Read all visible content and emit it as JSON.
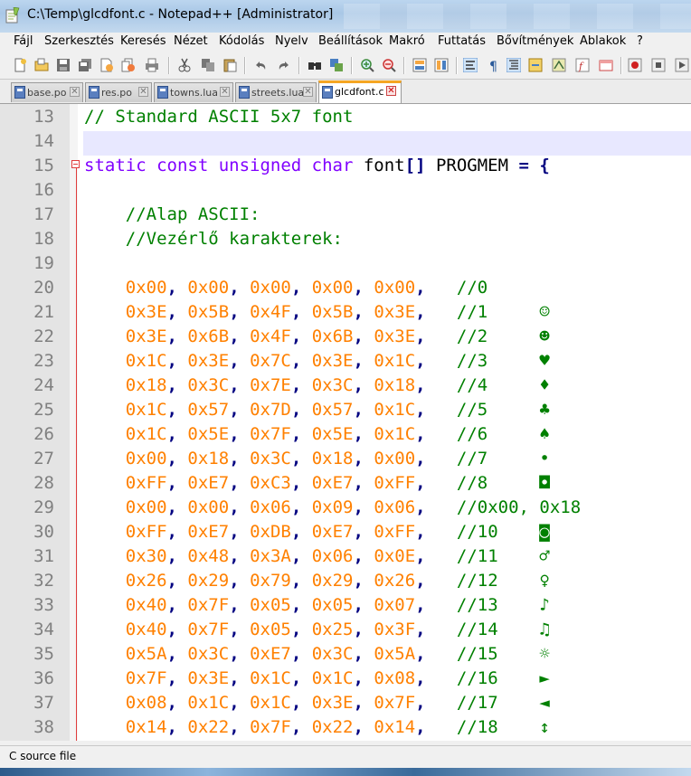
{
  "window": {
    "title": "C:\\Temp\\glcdfont.c - Notepad++ [Administrator]"
  },
  "menu": [
    {
      "label": "Fájl"
    },
    {
      "label": "Szerkesztés"
    },
    {
      "label": "Keresés"
    },
    {
      "label": "Nézet"
    },
    {
      "label": "Kódolás"
    },
    {
      "label": "Nyelv"
    },
    {
      "label": "Beállítások"
    },
    {
      "label": "Makró"
    },
    {
      "label": "Futtatás"
    },
    {
      "label": "Bővítmények"
    },
    {
      "label": "Ablakok"
    },
    {
      "label": "?"
    }
  ],
  "tabs": [
    {
      "label": "base.po",
      "active": false
    },
    {
      "label": "res.po",
      "active": false
    },
    {
      "label": "towns.lua",
      "active": false
    },
    {
      "label": "streets.lua",
      "active": false
    },
    {
      "label": "glcdfont.c",
      "active": true
    }
  ],
  "tab_close_glyph": "✕",
  "editor": {
    "current_line": 14,
    "lines": [
      {
        "n": "13",
        "segs": [
          {
            "t": "// Standard ASCII 5x7 font",
            "c": "cm"
          }
        ]
      },
      {
        "n": "14",
        "segs": []
      },
      {
        "n": "15",
        "segs": [
          {
            "t": "static const unsigned char",
            "c": "kw"
          },
          {
            "t": " font",
            "c": "pl"
          },
          {
            "t": "[]",
            "c": "op"
          },
          {
            "t": " PROGMEM ",
            "c": "pl"
          },
          {
            "t": "= {",
            "c": "op"
          }
        ]
      },
      {
        "n": "16",
        "segs": []
      },
      {
        "n": "17",
        "segs": [
          {
            "t": "    //Alap ASCII:",
            "c": "cm"
          }
        ]
      },
      {
        "n": "18",
        "segs": [
          {
            "t": "    //Vezérlő karakterek:",
            "c": "cm"
          }
        ]
      },
      {
        "n": "19",
        "segs": []
      },
      {
        "n": "20",
        "segs": [
          {
            "t": "    ",
            "c": "pl"
          },
          {
            "t": "0x00",
            "c": "hex"
          },
          {
            "t": ", ",
            "c": "op"
          },
          {
            "t": "0x00",
            "c": "hex"
          },
          {
            "t": ", ",
            "c": "op"
          },
          {
            "t": "0x00",
            "c": "hex"
          },
          {
            "t": ", ",
            "c": "op"
          },
          {
            "t": "0x00",
            "c": "hex"
          },
          {
            "t": ", ",
            "c": "op"
          },
          {
            "t": "0x00",
            "c": "hex"
          },
          {
            "t": ",   ",
            "c": "op"
          },
          {
            "t": "//0",
            "c": "cm"
          }
        ]
      },
      {
        "n": "21",
        "segs": [
          {
            "t": "    ",
            "c": "pl"
          },
          {
            "t": "0x3E",
            "c": "hex"
          },
          {
            "t": ", ",
            "c": "op"
          },
          {
            "t": "0x5B",
            "c": "hex"
          },
          {
            "t": ", ",
            "c": "op"
          },
          {
            "t": "0x4F",
            "c": "hex"
          },
          {
            "t": ", ",
            "c": "op"
          },
          {
            "t": "0x5B",
            "c": "hex"
          },
          {
            "t": ", ",
            "c": "op"
          },
          {
            "t": "0x3E",
            "c": "hex"
          },
          {
            "t": ",   ",
            "c": "op"
          },
          {
            "t": "//1     ☺",
            "c": "cm"
          }
        ]
      },
      {
        "n": "22",
        "segs": [
          {
            "t": "    ",
            "c": "pl"
          },
          {
            "t": "0x3E",
            "c": "hex"
          },
          {
            "t": ", ",
            "c": "op"
          },
          {
            "t": "0x6B",
            "c": "hex"
          },
          {
            "t": ", ",
            "c": "op"
          },
          {
            "t": "0x4F",
            "c": "hex"
          },
          {
            "t": ", ",
            "c": "op"
          },
          {
            "t": "0x6B",
            "c": "hex"
          },
          {
            "t": ", ",
            "c": "op"
          },
          {
            "t": "0x3E",
            "c": "hex"
          },
          {
            "t": ",   ",
            "c": "op"
          },
          {
            "t": "//2     ☻",
            "c": "cm"
          }
        ]
      },
      {
        "n": "23",
        "segs": [
          {
            "t": "    ",
            "c": "pl"
          },
          {
            "t": "0x1C",
            "c": "hex"
          },
          {
            "t": ", ",
            "c": "op"
          },
          {
            "t": "0x3E",
            "c": "hex"
          },
          {
            "t": ", ",
            "c": "op"
          },
          {
            "t": "0x7C",
            "c": "hex"
          },
          {
            "t": ", ",
            "c": "op"
          },
          {
            "t": "0x3E",
            "c": "hex"
          },
          {
            "t": ", ",
            "c": "op"
          },
          {
            "t": "0x1C",
            "c": "hex"
          },
          {
            "t": ",   ",
            "c": "op"
          },
          {
            "t": "//3     ♥",
            "c": "cm"
          }
        ]
      },
      {
        "n": "24",
        "segs": [
          {
            "t": "    ",
            "c": "pl"
          },
          {
            "t": "0x18",
            "c": "hex"
          },
          {
            "t": ", ",
            "c": "op"
          },
          {
            "t": "0x3C",
            "c": "hex"
          },
          {
            "t": ", ",
            "c": "op"
          },
          {
            "t": "0x7E",
            "c": "hex"
          },
          {
            "t": ", ",
            "c": "op"
          },
          {
            "t": "0x3C",
            "c": "hex"
          },
          {
            "t": ", ",
            "c": "op"
          },
          {
            "t": "0x18",
            "c": "hex"
          },
          {
            "t": ",   ",
            "c": "op"
          },
          {
            "t": "//4     ♦",
            "c": "cm"
          }
        ]
      },
      {
        "n": "25",
        "segs": [
          {
            "t": "    ",
            "c": "pl"
          },
          {
            "t": "0x1C",
            "c": "hex"
          },
          {
            "t": ", ",
            "c": "op"
          },
          {
            "t": "0x57",
            "c": "hex"
          },
          {
            "t": ", ",
            "c": "op"
          },
          {
            "t": "0x7D",
            "c": "hex"
          },
          {
            "t": ", ",
            "c": "op"
          },
          {
            "t": "0x57",
            "c": "hex"
          },
          {
            "t": ", ",
            "c": "op"
          },
          {
            "t": "0x1C",
            "c": "hex"
          },
          {
            "t": ",   ",
            "c": "op"
          },
          {
            "t": "//5     ♣",
            "c": "cm"
          }
        ]
      },
      {
        "n": "26",
        "segs": [
          {
            "t": "    ",
            "c": "pl"
          },
          {
            "t": "0x1C",
            "c": "hex"
          },
          {
            "t": ", ",
            "c": "op"
          },
          {
            "t": "0x5E",
            "c": "hex"
          },
          {
            "t": ", ",
            "c": "op"
          },
          {
            "t": "0x7F",
            "c": "hex"
          },
          {
            "t": ", ",
            "c": "op"
          },
          {
            "t": "0x5E",
            "c": "hex"
          },
          {
            "t": ", ",
            "c": "op"
          },
          {
            "t": "0x1C",
            "c": "hex"
          },
          {
            "t": ",   ",
            "c": "op"
          },
          {
            "t": "//6     ♠",
            "c": "cm"
          }
        ]
      },
      {
        "n": "27",
        "segs": [
          {
            "t": "    ",
            "c": "pl"
          },
          {
            "t": "0x00",
            "c": "hex"
          },
          {
            "t": ", ",
            "c": "op"
          },
          {
            "t": "0x18",
            "c": "hex"
          },
          {
            "t": ", ",
            "c": "op"
          },
          {
            "t": "0x3C",
            "c": "hex"
          },
          {
            "t": ", ",
            "c": "op"
          },
          {
            "t": "0x18",
            "c": "hex"
          },
          {
            "t": ", ",
            "c": "op"
          },
          {
            "t": "0x00",
            "c": "hex"
          },
          {
            "t": ",   ",
            "c": "op"
          },
          {
            "t": "//7     •",
            "c": "cm"
          }
        ]
      },
      {
        "n": "28",
        "segs": [
          {
            "t": "    ",
            "c": "pl"
          },
          {
            "t": "0xFF",
            "c": "hex"
          },
          {
            "t": ", ",
            "c": "op"
          },
          {
            "t": "0xE7",
            "c": "hex"
          },
          {
            "t": ", ",
            "c": "op"
          },
          {
            "t": "0xC3",
            "c": "hex"
          },
          {
            "t": ", ",
            "c": "op"
          },
          {
            "t": "0xE7",
            "c": "hex"
          },
          {
            "t": ", ",
            "c": "op"
          },
          {
            "t": "0xFF",
            "c": "hex"
          },
          {
            "t": ",   ",
            "c": "op"
          },
          {
            "t": "//8     ◘",
            "c": "cm"
          }
        ]
      },
      {
        "n": "29",
        "segs": [
          {
            "t": "    ",
            "c": "pl"
          },
          {
            "t": "0x00",
            "c": "hex"
          },
          {
            "t": ", ",
            "c": "op"
          },
          {
            "t": "0x00",
            "c": "hex"
          },
          {
            "t": ", ",
            "c": "op"
          },
          {
            "t": "0x06",
            "c": "hex"
          },
          {
            "t": ", ",
            "c": "op"
          },
          {
            "t": "0x09",
            "c": "hex"
          },
          {
            "t": ", ",
            "c": "op"
          },
          {
            "t": "0x06",
            "c": "hex"
          },
          {
            "t": ",   ",
            "c": "op"
          },
          {
            "t": "//0x00, 0x18",
            "c": "cm"
          }
        ]
      },
      {
        "n": "30",
        "segs": [
          {
            "t": "    ",
            "c": "pl"
          },
          {
            "t": "0xFF",
            "c": "hex"
          },
          {
            "t": ", ",
            "c": "op"
          },
          {
            "t": "0xE7",
            "c": "hex"
          },
          {
            "t": ", ",
            "c": "op"
          },
          {
            "t": "0xDB",
            "c": "hex"
          },
          {
            "t": ", ",
            "c": "op"
          },
          {
            "t": "0xE7",
            "c": "hex"
          },
          {
            "t": ", ",
            "c": "op"
          },
          {
            "t": "0xFF",
            "c": "hex"
          },
          {
            "t": ",   ",
            "c": "op"
          },
          {
            "t": "//10    ◙",
            "c": "cm"
          }
        ]
      },
      {
        "n": "31",
        "segs": [
          {
            "t": "    ",
            "c": "pl"
          },
          {
            "t": "0x30",
            "c": "hex"
          },
          {
            "t": ", ",
            "c": "op"
          },
          {
            "t": "0x48",
            "c": "hex"
          },
          {
            "t": ", ",
            "c": "op"
          },
          {
            "t": "0x3A",
            "c": "hex"
          },
          {
            "t": ", ",
            "c": "op"
          },
          {
            "t": "0x06",
            "c": "hex"
          },
          {
            "t": ", ",
            "c": "op"
          },
          {
            "t": "0x0E",
            "c": "hex"
          },
          {
            "t": ",   ",
            "c": "op"
          },
          {
            "t": "//11    ♂",
            "c": "cm"
          }
        ]
      },
      {
        "n": "32",
        "segs": [
          {
            "t": "    ",
            "c": "pl"
          },
          {
            "t": "0x26",
            "c": "hex"
          },
          {
            "t": ", ",
            "c": "op"
          },
          {
            "t": "0x29",
            "c": "hex"
          },
          {
            "t": ", ",
            "c": "op"
          },
          {
            "t": "0x79",
            "c": "hex"
          },
          {
            "t": ", ",
            "c": "op"
          },
          {
            "t": "0x29",
            "c": "hex"
          },
          {
            "t": ", ",
            "c": "op"
          },
          {
            "t": "0x26",
            "c": "hex"
          },
          {
            "t": ",   ",
            "c": "op"
          },
          {
            "t": "//12    ♀",
            "c": "cm"
          }
        ]
      },
      {
        "n": "33",
        "segs": [
          {
            "t": "    ",
            "c": "pl"
          },
          {
            "t": "0x40",
            "c": "hex"
          },
          {
            "t": ", ",
            "c": "op"
          },
          {
            "t": "0x7F",
            "c": "hex"
          },
          {
            "t": ", ",
            "c": "op"
          },
          {
            "t": "0x05",
            "c": "hex"
          },
          {
            "t": ", ",
            "c": "op"
          },
          {
            "t": "0x05",
            "c": "hex"
          },
          {
            "t": ", ",
            "c": "op"
          },
          {
            "t": "0x07",
            "c": "hex"
          },
          {
            "t": ",   ",
            "c": "op"
          },
          {
            "t": "//13    ♪",
            "c": "cm"
          }
        ]
      },
      {
        "n": "34",
        "segs": [
          {
            "t": "    ",
            "c": "pl"
          },
          {
            "t": "0x40",
            "c": "hex"
          },
          {
            "t": ", ",
            "c": "op"
          },
          {
            "t": "0x7F",
            "c": "hex"
          },
          {
            "t": ", ",
            "c": "op"
          },
          {
            "t": "0x05",
            "c": "hex"
          },
          {
            "t": ", ",
            "c": "op"
          },
          {
            "t": "0x25",
            "c": "hex"
          },
          {
            "t": ", ",
            "c": "op"
          },
          {
            "t": "0x3F",
            "c": "hex"
          },
          {
            "t": ",   ",
            "c": "op"
          },
          {
            "t": "//14    ♫",
            "c": "cm"
          }
        ]
      },
      {
        "n": "35",
        "segs": [
          {
            "t": "    ",
            "c": "pl"
          },
          {
            "t": "0x5A",
            "c": "hex"
          },
          {
            "t": ", ",
            "c": "op"
          },
          {
            "t": "0x3C",
            "c": "hex"
          },
          {
            "t": ", ",
            "c": "op"
          },
          {
            "t": "0xE7",
            "c": "hex"
          },
          {
            "t": ", ",
            "c": "op"
          },
          {
            "t": "0x3C",
            "c": "hex"
          },
          {
            "t": ", ",
            "c": "op"
          },
          {
            "t": "0x5A",
            "c": "hex"
          },
          {
            "t": ",   ",
            "c": "op"
          },
          {
            "t": "//15    ☼",
            "c": "cm"
          }
        ]
      },
      {
        "n": "36",
        "segs": [
          {
            "t": "    ",
            "c": "pl"
          },
          {
            "t": "0x7F",
            "c": "hex"
          },
          {
            "t": ", ",
            "c": "op"
          },
          {
            "t": "0x3E",
            "c": "hex"
          },
          {
            "t": ", ",
            "c": "op"
          },
          {
            "t": "0x1C",
            "c": "hex"
          },
          {
            "t": ", ",
            "c": "op"
          },
          {
            "t": "0x1C",
            "c": "hex"
          },
          {
            "t": ", ",
            "c": "op"
          },
          {
            "t": "0x08",
            "c": "hex"
          },
          {
            "t": ",   ",
            "c": "op"
          },
          {
            "t": "//16    ►",
            "c": "cm"
          }
        ]
      },
      {
        "n": "37",
        "segs": [
          {
            "t": "    ",
            "c": "pl"
          },
          {
            "t": "0x08",
            "c": "hex"
          },
          {
            "t": ", ",
            "c": "op"
          },
          {
            "t": "0x1C",
            "c": "hex"
          },
          {
            "t": ", ",
            "c": "op"
          },
          {
            "t": "0x1C",
            "c": "hex"
          },
          {
            "t": ", ",
            "c": "op"
          },
          {
            "t": "0x3E",
            "c": "hex"
          },
          {
            "t": ", ",
            "c": "op"
          },
          {
            "t": "0x7F",
            "c": "hex"
          },
          {
            "t": ",   ",
            "c": "op"
          },
          {
            "t": "//17    ◄",
            "c": "cm"
          }
        ]
      },
      {
        "n": "38",
        "segs": [
          {
            "t": "    ",
            "c": "pl"
          },
          {
            "t": "0x14",
            "c": "hex"
          },
          {
            "t": ", ",
            "c": "op"
          },
          {
            "t": "0x22",
            "c": "hex"
          },
          {
            "t": ", ",
            "c": "op"
          },
          {
            "t": "0x7F",
            "c": "hex"
          },
          {
            "t": ", ",
            "c": "op"
          },
          {
            "t": "0x22",
            "c": "hex"
          },
          {
            "t": ", ",
            "c": "op"
          },
          {
            "t": "0x14",
            "c": "hex"
          },
          {
            "t": ",   ",
            "c": "op"
          },
          {
            "t": "//18    ↕",
            "c": "cm"
          }
        ]
      }
    ]
  },
  "status": {
    "file_type": "C source file"
  },
  "colors": {
    "comment": "#008000",
    "keyword": "#8000ff",
    "number": "#ff8000",
    "operator": "#000080",
    "current_line": "#e8e8ff",
    "fold_margin": "#e03c3c"
  }
}
